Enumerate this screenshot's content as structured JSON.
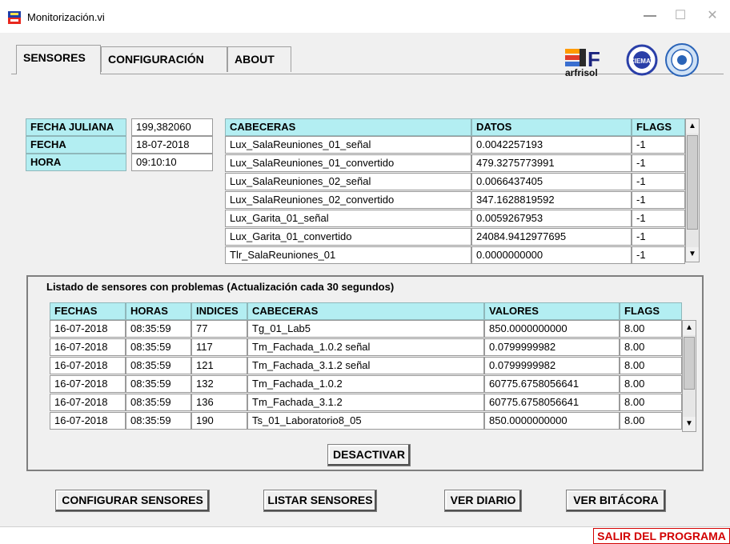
{
  "window": {
    "title": "Monitorización.vi",
    "controls": {
      "minimize": "—",
      "maximize": "☐",
      "close": "✕"
    }
  },
  "tabs": [
    {
      "label": "SENSORES",
      "active": true
    },
    {
      "label": "CONFIGURACIÓN",
      "active": false
    },
    {
      "label": "ABOUT",
      "active": false
    }
  ],
  "logos": {
    "text": "arfrisol",
    "letter": "F",
    "ciemat": "CIEMAT"
  },
  "date_info": {
    "rows": [
      {
        "label": "FECHA JULIANA",
        "value": "199,382060"
      },
      {
        "label": "FECHA",
        "value": "18-07-2018"
      },
      {
        "label": "HORA",
        "value": "09:10:10"
      }
    ]
  },
  "sensors_table": {
    "headers": [
      "CABECERAS",
      "DATOS",
      "FLAGS"
    ],
    "rows": [
      [
        "Lux_SalaReuniones_01_señal",
        "0.0042257193",
        "-1"
      ],
      [
        "Lux_SalaReuniones_01_convertido",
        "479.3275773991",
        "-1"
      ],
      [
        "Lux_SalaReuniones_02_señal",
        "0.0066437405",
        "-1"
      ],
      [
        "Lux_SalaReuniones_02_convertido",
        "347.1628819592",
        "-1"
      ],
      [
        "Lux_Garita_01_señal",
        "0.0059267953",
        "-1"
      ],
      [
        "Lux_Garita_01_convertido",
        "24084.9412977695",
        "-1"
      ],
      [
        "Tlr_SalaReuniones_01",
        "0.0000000000",
        "-1"
      ]
    ]
  },
  "problems": {
    "title": "Listado de sensores con problemas (Actualización cada 30 segundos)",
    "headers": [
      "FECHAS",
      "HORAS",
      "INDICES",
      "CABECERAS",
      "VALORES",
      "FLAGS"
    ],
    "rows": [
      [
        "16-07-2018",
        "08:35:59",
        "77",
        "Tg_01_Lab5",
        "850.0000000000",
        "8.00"
      ],
      [
        "16-07-2018",
        "08:35:59",
        "117",
        "Tm_Fachada_1.0.2 señal",
        "0.0799999982",
        "8.00"
      ],
      [
        "16-07-2018",
        "08:35:59",
        "121",
        "Tm_Fachada_3.1.2 señal",
        "0.0799999982",
        "8.00"
      ],
      [
        "16-07-2018",
        "08:35:59",
        "132",
        "Tm_Fachada_1.0.2",
        "60775.6758056641",
        "8.00"
      ],
      [
        "16-07-2018",
        "08:35:59",
        "136",
        "Tm_Fachada_3.1.2",
        "60775.6758056641",
        "8.00"
      ],
      [
        "16-07-2018",
        "08:35:59",
        "190",
        "Ts_01_Laboratorio8_05",
        "850.0000000000",
        "8.00"
      ]
    ],
    "deactivate_label": "DESACTIVAR"
  },
  "buttons": {
    "configure": "CONFIGURAR SENSORES",
    "list": "LISTAR SENSORES",
    "diary": "VER DIARIO",
    "log": "VER BITÁCORA",
    "exit": "SALIR DEL PROGRAMA"
  },
  "colors": {
    "header_bg": "#b3eef2",
    "exit_text": "#d20000",
    "panel_bg": "#f0f0f0"
  }
}
